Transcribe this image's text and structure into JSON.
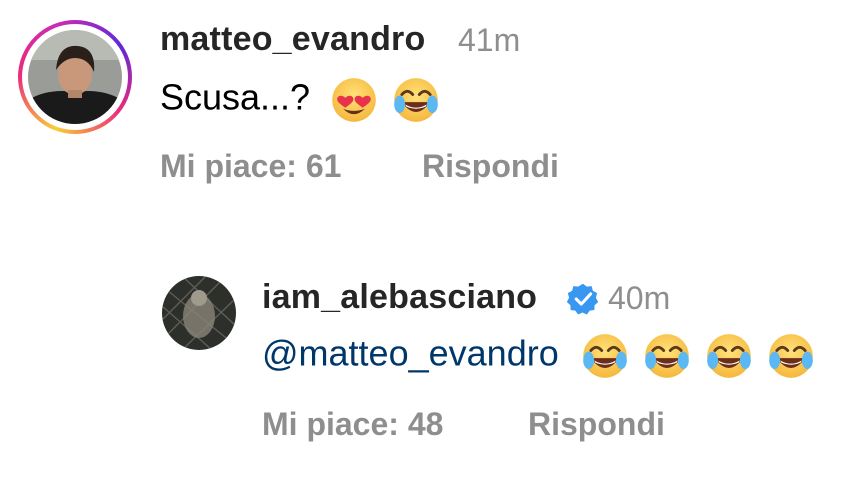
{
  "comments": [
    {
      "username": "matteo_evandro",
      "time": "41m",
      "text": "Scusa...?",
      "emojis": [
        "heart-eyes-emoji",
        "tears-of-joy-emoji"
      ],
      "likes_label": "Mi piace: 61",
      "reply_label": "Rispondi",
      "has_story_ring": true
    },
    {
      "username": "iam_alebasciano",
      "verified": true,
      "time": "40m",
      "mention": "@matteo_evandro",
      "emojis": [
        "tears-of-joy-emoji",
        "tears-of-joy-emoji",
        "tears-of-joy-emoji",
        "tears-of-joy-emoji"
      ],
      "likes_label": "Mi piace: 48",
      "reply_label": "Rispondi"
    }
  ],
  "colors": {
    "username": "#262626",
    "secondary": "#8e8e8e",
    "mention": "#00376b",
    "verified": "#3897f0"
  }
}
